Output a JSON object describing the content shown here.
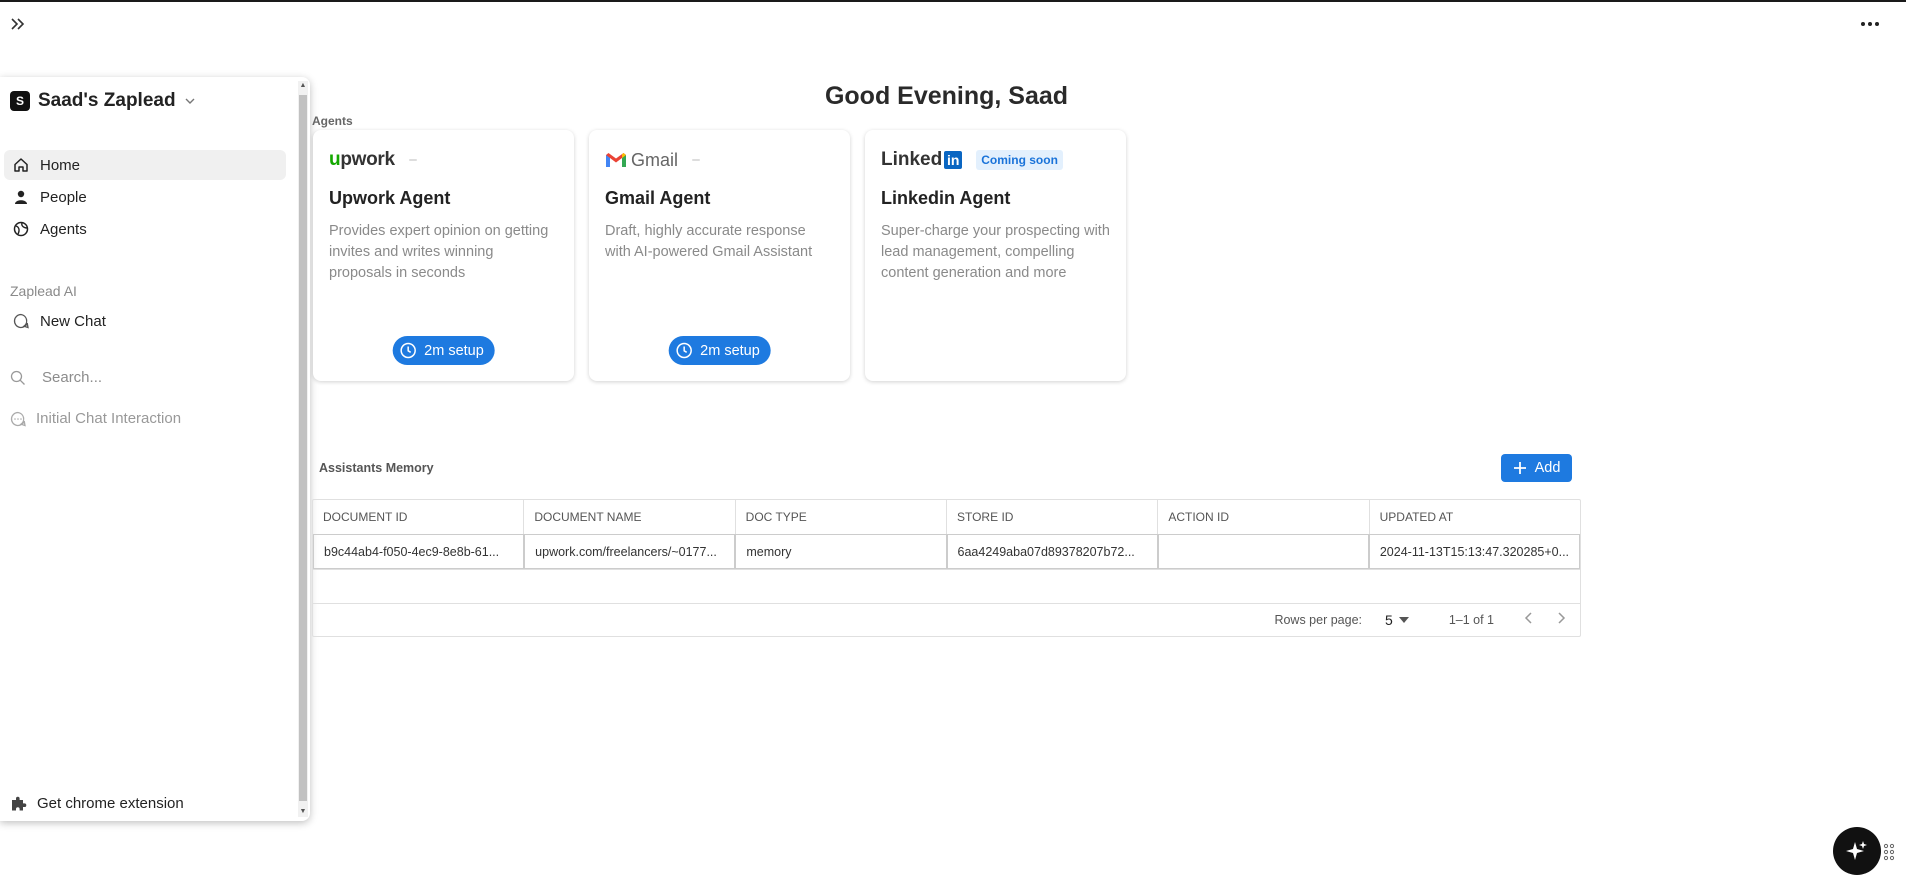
{
  "workspace": {
    "avatar_letter": "S",
    "name": "Saad's Zaplead"
  },
  "sidebar": {
    "nav": [
      {
        "label": "Home",
        "icon": "home-icon",
        "active": true
      },
      {
        "label": "People",
        "icon": "person-icon",
        "active": false
      },
      {
        "label": "Agents",
        "icon": "globe-icon",
        "active": false
      }
    ],
    "section_label": "Zaplead AI",
    "new_chat": "New Chat",
    "search_placeholder": "Search...",
    "chats": [
      "Initial Chat Interaction"
    ],
    "chrome_extension": "Get chrome extension"
  },
  "main": {
    "greeting": "Good Evening, Saad",
    "agents_label": "Agents",
    "agents": [
      {
        "logo_text": "upwork",
        "title": "Upwork Agent",
        "description": "Provides expert opinion on getting invites and writes winning proposals in seconds",
        "setup_label": "2m setup"
      },
      {
        "logo_text": "Gmail",
        "title": "Gmail Agent",
        "description": "Draft, highly accurate response with AI-powered Gmail Assistant",
        "setup_label": "2m setup"
      },
      {
        "logo_text": "Linked",
        "logo_box": "in",
        "badge": "Coming soon",
        "title": "Linkedin Agent",
        "description": "Super-charge your prospecting with lead management, compelling content generation and more"
      }
    ]
  },
  "memory": {
    "title": "Assistants Memory",
    "add_label": "Add",
    "columns": [
      "DOCUMENT ID",
      "DOCUMENT NAME",
      "DOC TYPE",
      "STORE ID",
      "ACTION ID",
      "UPDATED AT"
    ],
    "rows": [
      [
        "b9c44ab4-f050-4ec9-8e8b-61...",
        "upwork.com/freelancers/~0177...",
        "memory",
        "6aa4249aba07d89378207b72...",
        "",
        "2024-11-13T15:13:47.320285+0..."
      ]
    ],
    "rows_per_page_label": "Rows per page:",
    "rows_per_page_value": "5",
    "range_label": "1–1 of 1"
  },
  "colors": {
    "accent": "#1e7ae0",
    "upwork_green": "#14a800",
    "linkedin_blue": "#0a66c2"
  }
}
